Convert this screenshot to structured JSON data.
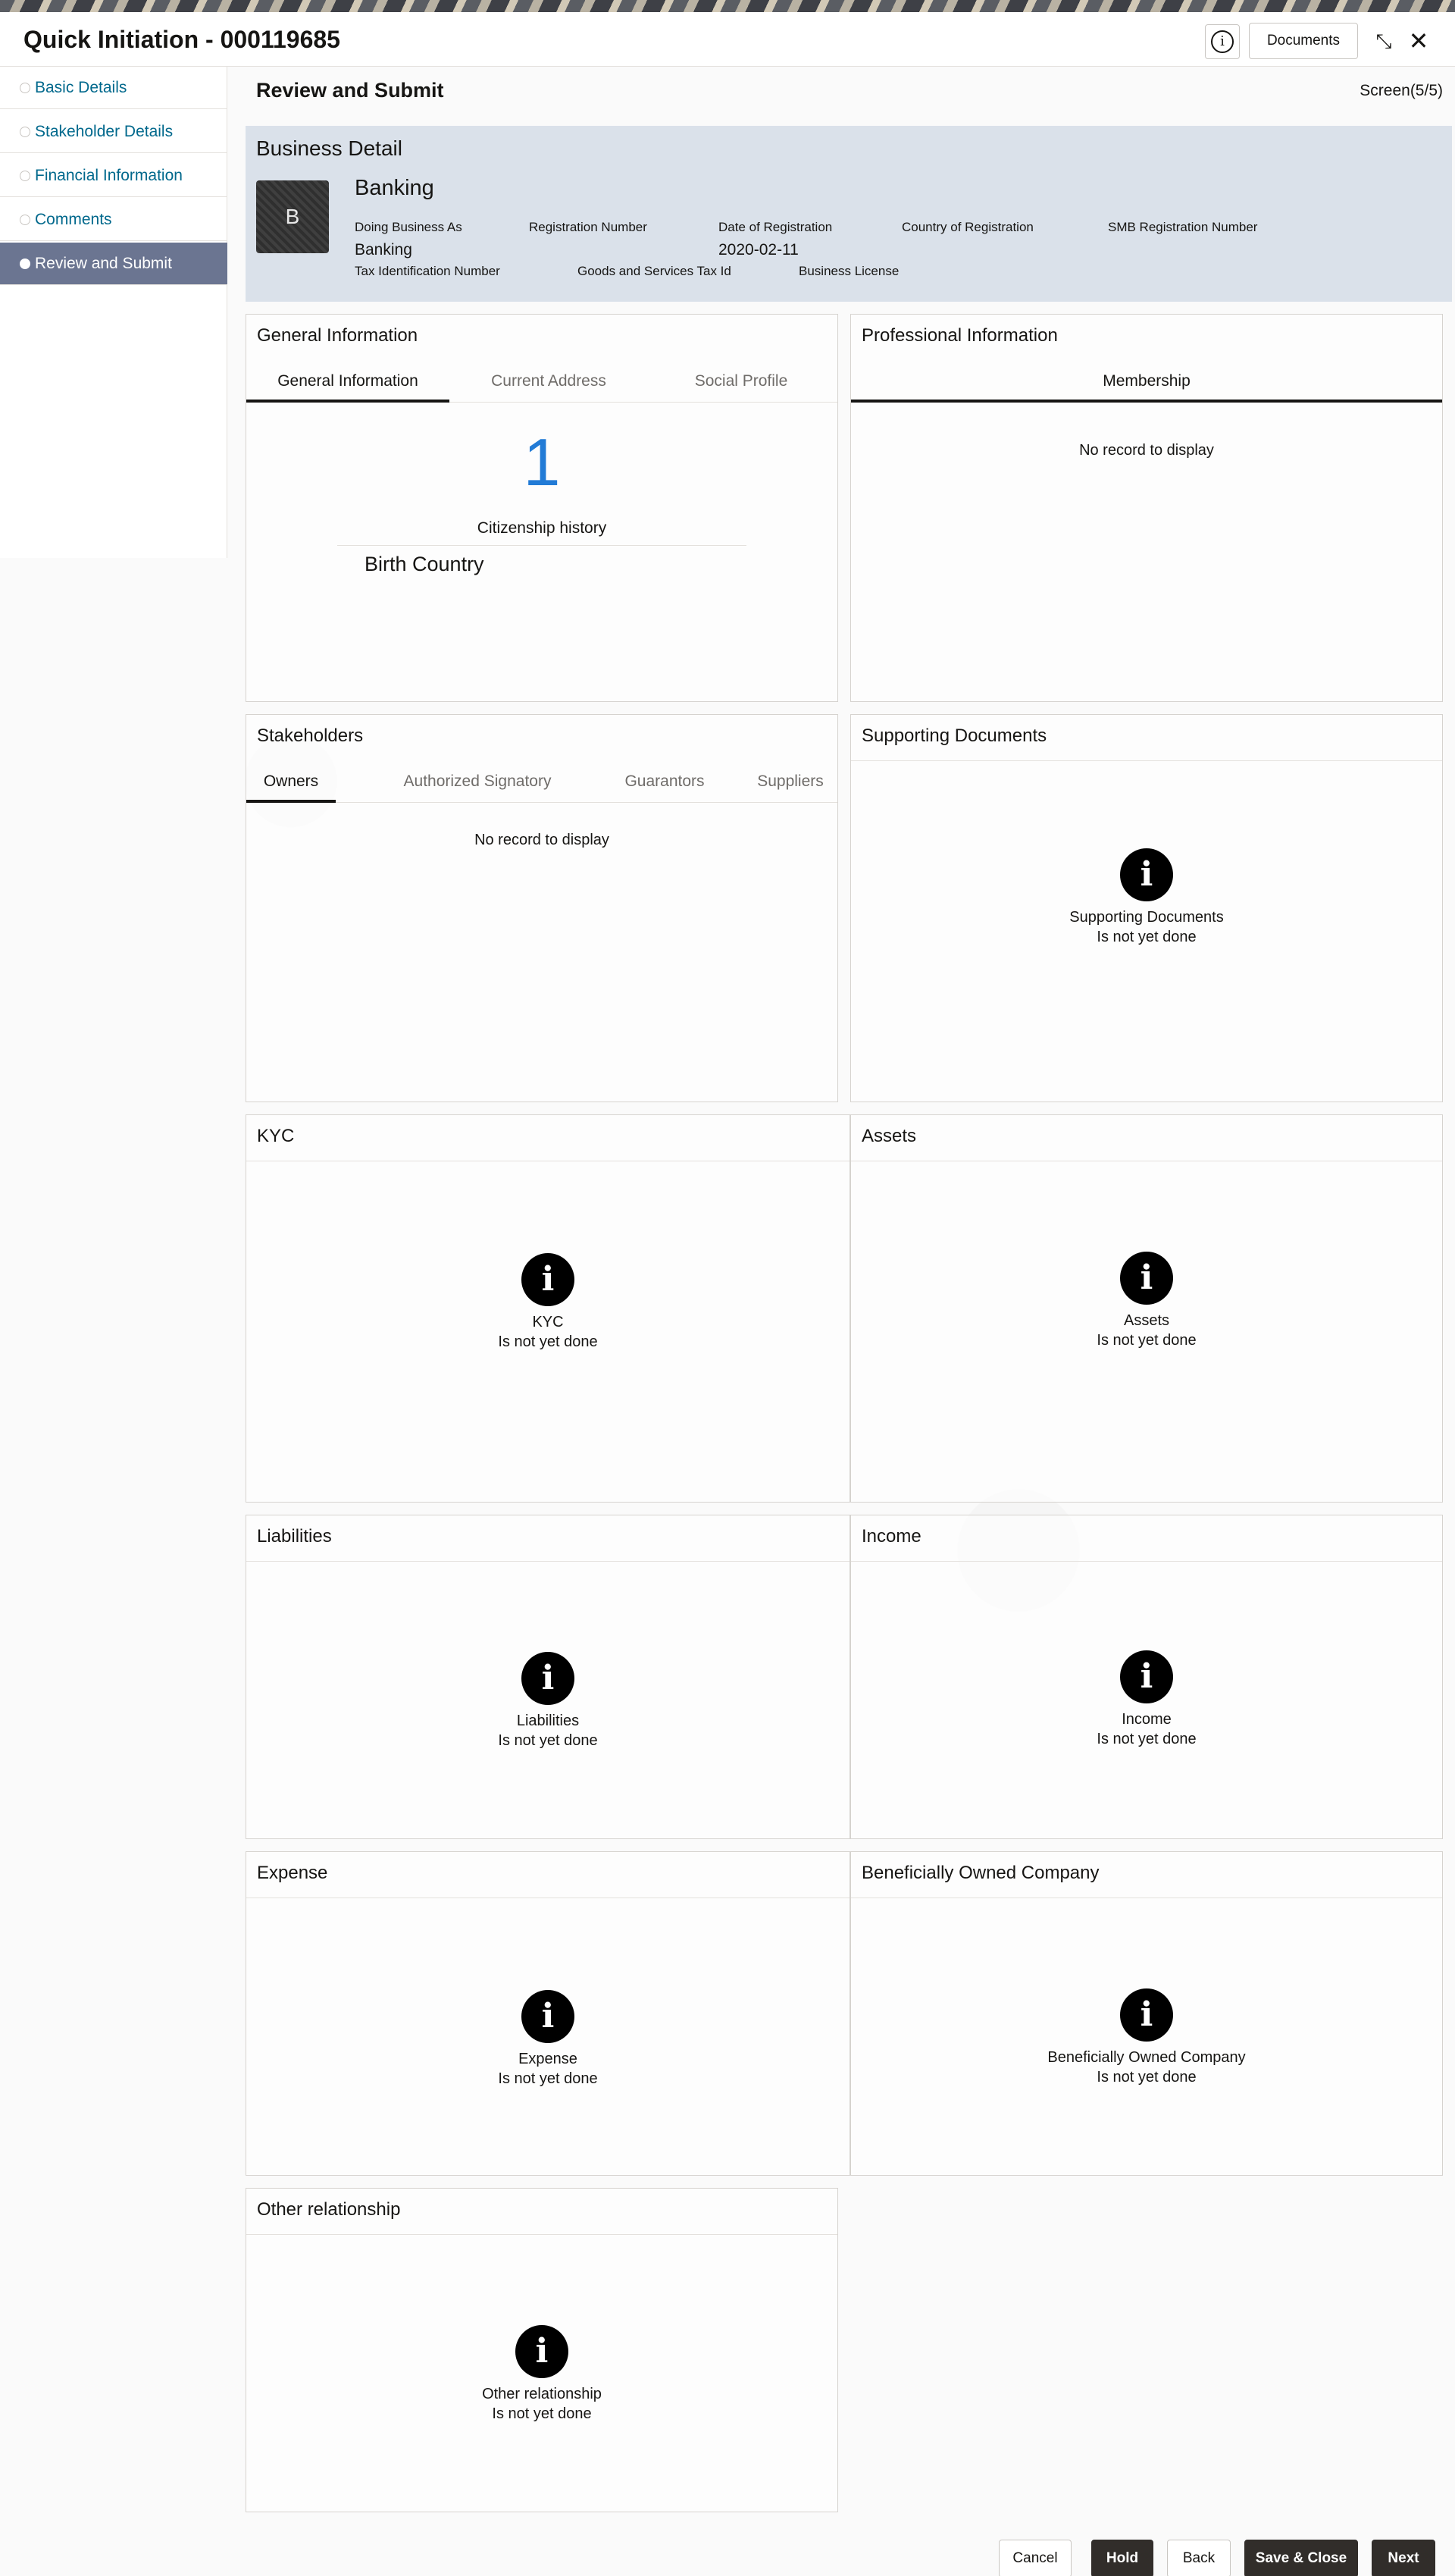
{
  "header": {
    "title": "Quick Initiation - 000119685",
    "info_glyph": "i",
    "documents_label": "Documents",
    "collapse_glyph": "⤡",
    "close_glyph": "✕"
  },
  "sidebar": {
    "items": [
      {
        "label": "Basic Details"
      },
      {
        "label": "Stakeholder Details"
      },
      {
        "label": "Financial Information"
      },
      {
        "label": "Comments"
      },
      {
        "label": "Review and Submit"
      }
    ]
  },
  "main": {
    "title": "Review and Submit",
    "screen_count": "Screen(5/5)"
  },
  "business": {
    "heading": "Business Detail",
    "avatar_letter": "B",
    "name": "Banking",
    "labels": {
      "dba": "Doing Business As",
      "reg_no": "Registration Number",
      "reg_date": "Date of Registration",
      "country": "Country of Registration",
      "smb": "SMB Registration Number",
      "tin": "Tax Identification Number",
      "gst": "Goods and Services Tax Id",
      "license": "Business License"
    },
    "values": {
      "dba": "Banking",
      "reg_date": "2020-02-11"
    }
  },
  "general": {
    "title": "General Information",
    "tabs": [
      "General Information",
      "Current Address",
      "Social Profile"
    ],
    "count": "1",
    "count_label": "Citizenship history",
    "birth_country": "Birth Country"
  },
  "professional": {
    "title": "Professional Information",
    "tab": "Membership",
    "empty": "No record to display"
  },
  "stakeholders": {
    "title": "Stakeholders",
    "tabs": [
      "Owners",
      "Authorized Signatory",
      "Guarantors",
      "Suppliers"
    ],
    "empty": "No record to display"
  },
  "sections": {
    "status": "Is not yet done",
    "icon_glyph": "i",
    "supporting": "Supporting Documents",
    "kyc": "KYC",
    "assets": "Assets",
    "liabilities": "Liabilities",
    "income": "Income",
    "expense": "Expense",
    "boc": "Beneficially Owned Company",
    "other": "Other relationship"
  },
  "footer": {
    "cancel": "Cancel",
    "hold": "Hold",
    "back": "Back",
    "save_close": "Save & Close",
    "next": "Next"
  }
}
